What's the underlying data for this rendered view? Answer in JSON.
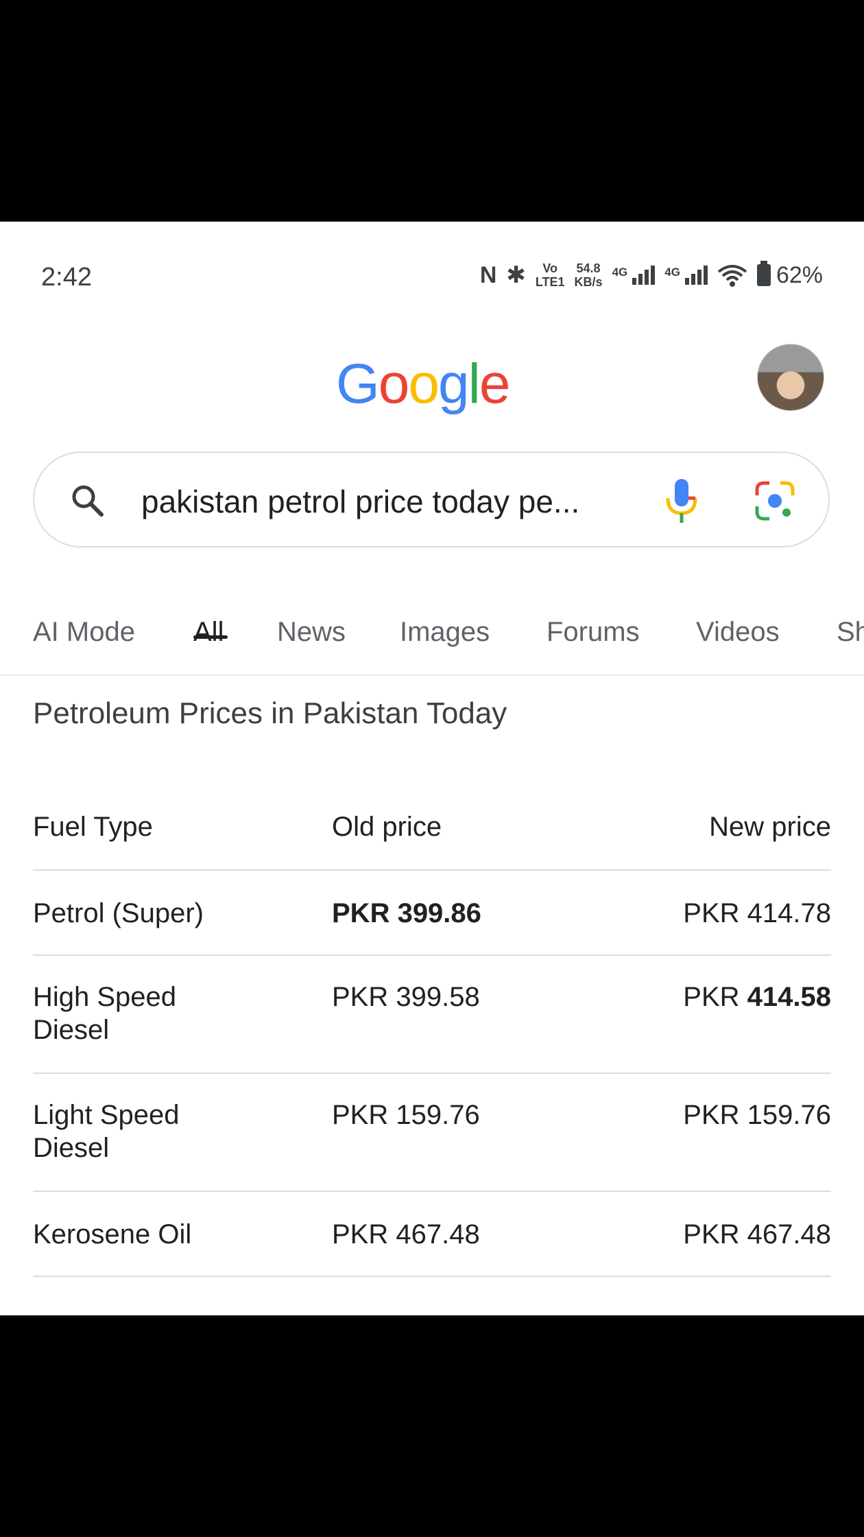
{
  "status_bar": {
    "time": "2:42",
    "nfc_glyph": "N",
    "bt_glyph": "✱",
    "volte_top": "Vo",
    "volte_bottom": "LTE1",
    "speed_value": "54.8",
    "speed_unit": "KB/s",
    "net1_tag": "4G",
    "net2_tag": "4G",
    "battery": "62%"
  },
  "logo": {
    "letters": [
      "G",
      "o",
      "o",
      "g",
      "l",
      "e"
    ],
    "colors": [
      "#4285F4",
      "#EA4335",
      "#FBBC05",
      "#4285F4",
      "#34A853",
      "#EA4335"
    ]
  },
  "search": {
    "query": "pakistan petrol price today pe..."
  },
  "tabs": [
    {
      "label": "AI Mode",
      "active": false
    },
    {
      "label": "All",
      "active": true
    },
    {
      "label": "News",
      "active": false
    },
    {
      "label": "Images",
      "active": false
    },
    {
      "label": "Forums",
      "active": false
    },
    {
      "label": "Videos",
      "active": false
    },
    {
      "label": "Sh",
      "active": false
    }
  ],
  "result": {
    "title": "Petroleum Prices in Pakistan Today",
    "headers": [
      "Fuel Type",
      "Old price",
      "New price"
    ],
    "rows": [
      {
        "fuel": "Petrol (Super)",
        "old": "PKR 399.86",
        "new": "PKR 414.78"
      },
      {
        "fuel": "High Speed\nDiesel",
        "old": "PKR 399.58",
        "new_prefix": "PKR ",
        "new_bold": "414.58"
      },
      {
        "fuel": "Light Speed\nDiesel",
        "old": "PKR 159.76",
        "new": "PKR 159.76"
      },
      {
        "fuel": "Kerosene Oil",
        "old": "PKR 467.48",
        "new": "PKR 467.48"
      }
    ]
  }
}
